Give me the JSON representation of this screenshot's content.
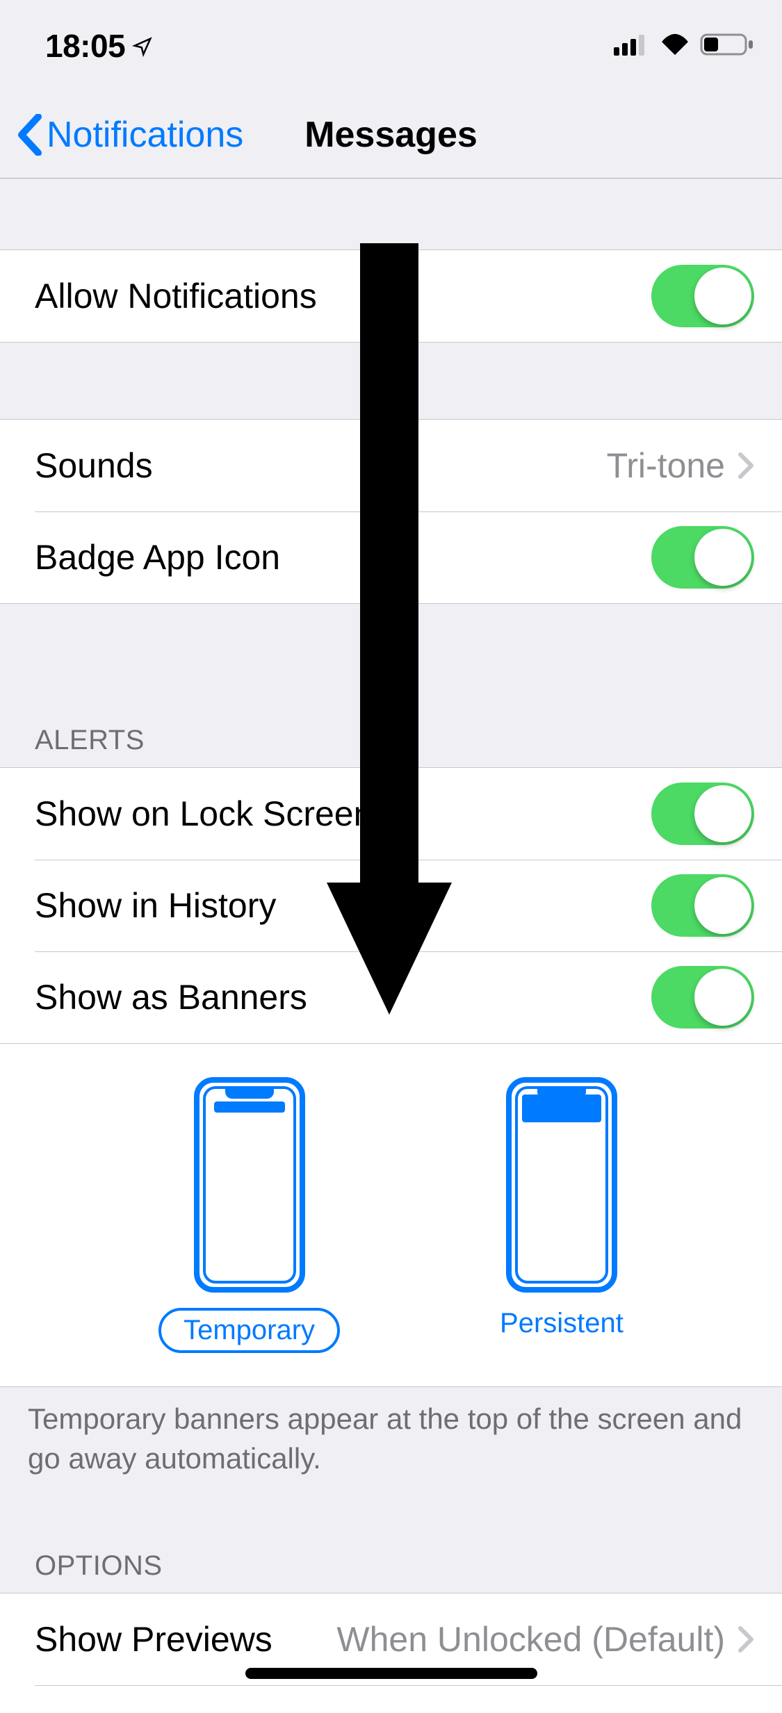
{
  "status": {
    "time": "18:05"
  },
  "nav": {
    "back_label": "Notifications",
    "title": "Messages"
  },
  "allow": {
    "label": "Allow Notifications"
  },
  "sounds": {
    "label": "Sounds",
    "value": "Tri-tone"
  },
  "badge": {
    "label": "Badge App Icon"
  },
  "headers": {
    "alerts": "ALERTS",
    "options": "OPTIONS"
  },
  "alerts": {
    "lock": "Show on Lock Screen",
    "history": "Show in History",
    "banners": "Show as Banners"
  },
  "banner_styles": {
    "temporary": "Temporary",
    "persistent": "Persistent"
  },
  "footer": {
    "banners": "Temporary banners appear at the top of the screen and go away automatically."
  },
  "options": {
    "previews_label": "Show Previews",
    "previews_value": "When Unlocked (Default)"
  }
}
